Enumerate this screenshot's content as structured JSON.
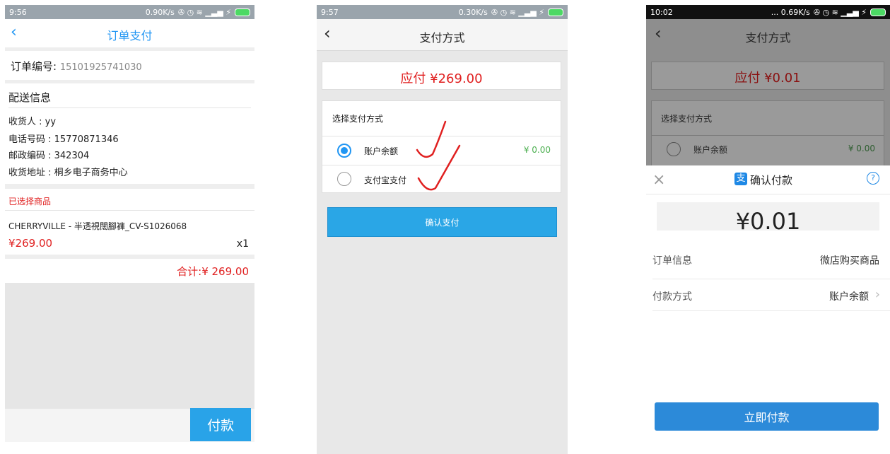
{
  "screen1": {
    "status": {
      "time": "9:56",
      "net": "0.90K/s"
    },
    "header": {
      "title": "订单支付"
    },
    "order_no": {
      "label": "订单编号:",
      "value": "15101925741030"
    },
    "delivery": {
      "heading": "配送信息",
      "receiver": "收货人 : yy",
      "phone": "电话号码 : 15770871346",
      "postal": "邮政编码 : 342304",
      "address": "收货地址 : 桐乡电子商务中心"
    },
    "goods": {
      "heading": "已选择商品",
      "name": "CHERRYVILLE - 半透視闊腳褲_CV-S1026068",
      "price": "¥269.00",
      "qty": "x1",
      "total": "合计:¥ 269.00"
    },
    "pay_button": "付款"
  },
  "screen2": {
    "status": {
      "time": "9:57",
      "net": "0.30K/s"
    },
    "header": {
      "title": "支付方式"
    },
    "amount": "应付 ¥269.00",
    "methods_heading": "选择支付方式",
    "methods": [
      {
        "label": "账户余额",
        "balance": "¥ 0.00",
        "selected": true
      },
      {
        "label": "支付宝支付",
        "selected": false
      }
    ],
    "confirm_button": "确认支付"
  },
  "screen3": {
    "status": {
      "time": "10:02",
      "net": "... 0.69K/s"
    },
    "header": {
      "title": "支付方式"
    },
    "amount": "应付 ¥0.01",
    "methods_heading": "选择支付方式",
    "method_label": "账户余额",
    "balance": "¥ 0.00",
    "sheet": {
      "title": "确认付款",
      "amount": "¥0.01",
      "order_info_label": "订单信息",
      "order_info_value": "微店购买商品",
      "pay_method_label": "付款方式",
      "pay_method_value": "账户余额",
      "pay_button": "立即付款"
    }
  },
  "colors": {
    "accent_blue": "#2196f3",
    "price_red": "#e02020",
    "alipay_blue": "#1e88e5"
  }
}
